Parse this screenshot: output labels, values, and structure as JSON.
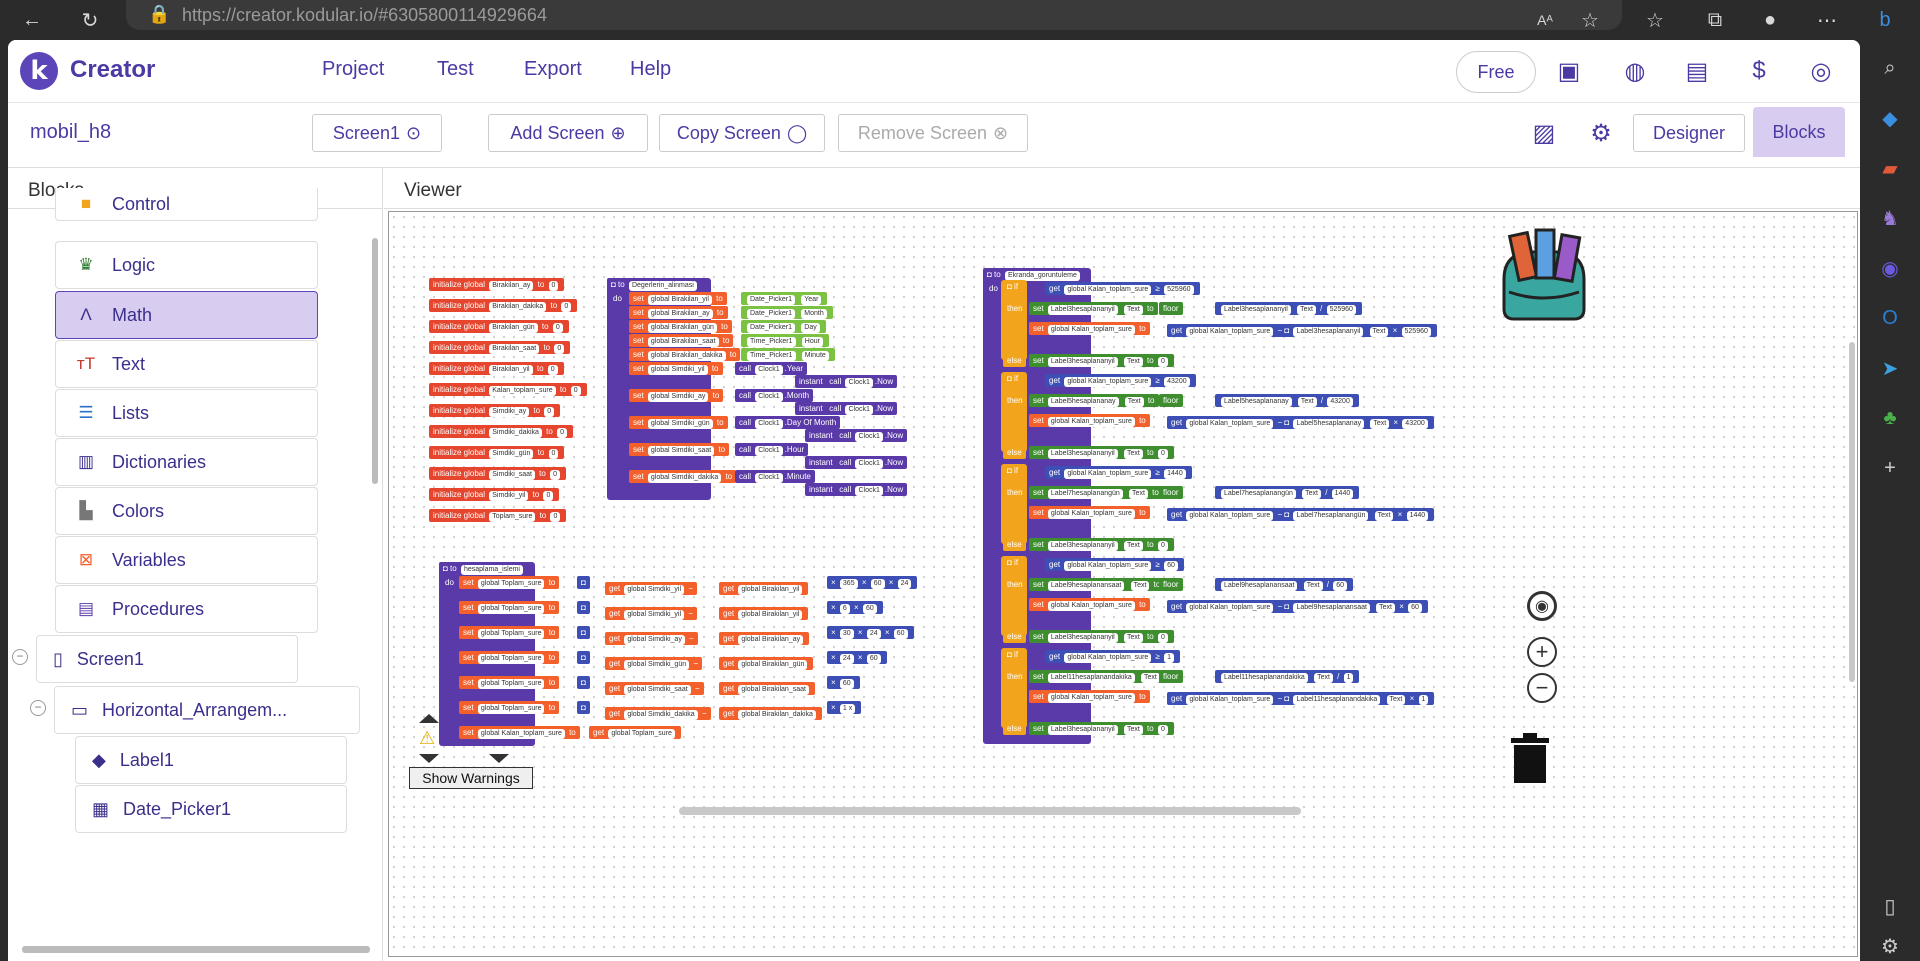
{
  "browser": {
    "url": "https://creator.kodular.io/#6305800114929664"
  },
  "topnav": {
    "brand": "Creator",
    "logo_letter": "k",
    "menus": [
      "Project",
      "Test",
      "Export",
      "Help"
    ],
    "free_label": "Free"
  },
  "toolbar": {
    "project_name": "mobil_h8",
    "screen_select": "Screen1",
    "add_screen": "Add Screen",
    "copy_screen": "Copy Screen",
    "remove_screen": "Remove Screen",
    "designer": "Designer",
    "blocks": "Blocks"
  },
  "left_panel": {
    "title": "Blocks",
    "items": [
      "Control",
      "Logic",
      "Math",
      "Text",
      "Lists",
      "Dictionaries",
      "Colors",
      "Variables",
      "Procedures"
    ],
    "selected": "Math",
    "tree": [
      "Screen1",
      "Horizontal_Arrangem...",
      "Label1",
      "Date_Picker1"
    ]
  },
  "viewer": {
    "title": "Viewer",
    "show_warnings": "Show Warnings",
    "warning_count": "0",
    "error_count": "0"
  },
  "blocks": {
    "globals": [
      "Birakilan_ay",
      "Birakilan_dakika",
      "Birakilan_gün",
      "Birakilan_saat",
      "Birakilan_yil",
      "Kalan_toplam_sure",
      "Simdiki_ay",
      "Simdiki_dakika",
      "Simdiki_gün",
      "Simdiki_saat",
      "Simdiki_yil",
      "Toplam_sure"
    ],
    "init_label": "initialize global",
    "to_label": "to",
    "zero": "0",
    "proc1": "Degerlerin_alinmasi",
    "proc2": "hesaplama_islemi",
    "proc3": "Ekranda_goruntuleme",
    "proc_prefix": "to",
    "do_label": "do",
    "set_rows1": [
      {
        "var": "Birakilan_yil",
        "src": "Date_Picker1",
        "prop": "Year"
      },
      {
        "var": "Birakilan_ay",
        "src": "Date_Picker1",
        "prop": "Month"
      },
      {
        "var": "Birakilan_gün",
        "src": "Date_Picker1",
        "prop": "Day"
      },
      {
        "var": "Birakilan_saat",
        "src": "Time_Picker1",
        "prop": "Hour"
      },
      {
        "var": "Birakilan_dakika",
        "src": "Time_Picker1",
        "prop": "Minute"
      }
    ],
    "clock_rows": [
      {
        "var": "Simdiki_yil",
        "prop": ".Year"
      },
      {
        "var": "Simdiki_ay",
        "prop": ".Month"
      },
      {
        "var": "Simdiki_gün",
        "prop": ".Day Of Month"
      },
      {
        "var": "Simdiki_saat",
        "prop": ".Hour"
      },
      {
        "var": "Simdiki_dakika",
        "prop": ".Minute"
      }
    ],
    "calc_rows": [
      {
        "a": "Simdiki_yil",
        "b": "Birakilan_yil",
        "mult": "365 x 60 x 24"
      },
      {
        "a": "Simdiki_yil",
        "b": "Birakilan_yil",
        "mult": "6 x 60"
      },
      {
        "a": "Simdiki_ay",
        "b": "Birakilan_ay",
        "mult": "30 x 24 x 60"
      },
      {
        "a": "Simdiki_gün",
        "b": "Birakilan_gün",
        "mult": "24 x 60"
      },
      {
        "a": "Simdiki_saat",
        "b": "Birakilan_saat",
        "mult": "60"
      },
      {
        "a": "Simdiki_dakika",
        "b": "Birakilan_dakika",
        "mult": "1 x"
      }
    ],
    "if_rows": [
      {
        "label": "Label3hesaplananyil",
        "num": "525960"
      },
      {
        "label": "Label5hesaplananay",
        "num": "43200"
      },
      {
        "label": "Label7hesaplanangün",
        "num": "1440"
      },
      {
        "label": "Label9hesaplanansaat",
        "num": "60"
      },
      {
        "label": "Label11hesaplanandakika",
        "num": "1"
      }
    ]
  }
}
